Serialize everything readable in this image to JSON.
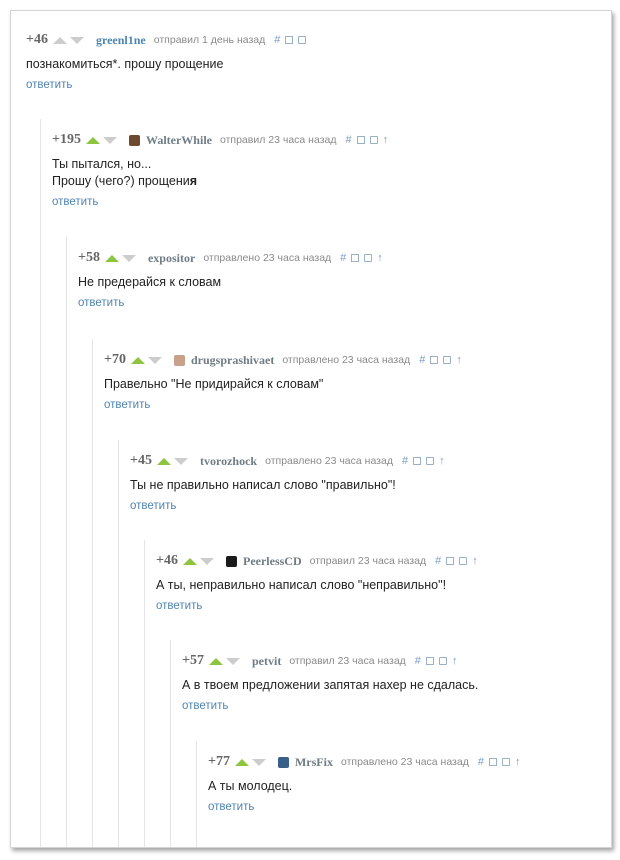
{
  "comments": [
    {
      "rating": "+46",
      "user": "greenl1ne",
      "meta": "отправил 1 день назад",
      "lines": [
        "познакомиться*. прошу прощение"
      ],
      "reply": "ответить",
      "up_active": false,
      "has_parent": false
    },
    {
      "rating": "+195",
      "user": "WalterWhile",
      "meta": "отправил 23 часа назад",
      "lines": [
        "Ты пытался, но...",
        "Прошу (чего?) прощени"
      ],
      "last_bold": "я",
      "reply": "ответить",
      "up_active": true,
      "has_parent": true,
      "avatar": "#6b4a2e"
    },
    {
      "rating": "+58",
      "user": "expositor",
      "meta": "отправлено 23 часа назад",
      "lines": [
        "Не предерайся к словам"
      ],
      "reply": "ответить",
      "up_active": true,
      "has_parent": true
    },
    {
      "rating": "+70",
      "user": "drugsprashivaet",
      "meta": "отправлено 23 часа назад",
      "lines": [
        "Правельно \"Не придирайся к словам\""
      ],
      "reply": "ответить",
      "up_active": true,
      "has_parent": true,
      "avatar": "#c9a089"
    },
    {
      "rating": "+45",
      "user": "tvorozhock",
      "meta": "отправлено 23 часа назад",
      "lines": [
        "Ты не правильно написал слово \"правильно\"!"
      ],
      "reply": "ответить",
      "up_active": true,
      "has_parent": true
    },
    {
      "rating": "+46",
      "user": "PeerlessCD",
      "meta": "отправил 23 часа назад",
      "lines": [
        "А ты, неправильно написал слово \"неправильно\"!"
      ],
      "reply": "ответить",
      "up_active": true,
      "has_parent": true,
      "avatar": "#1a1a1a"
    },
    {
      "rating": "+57",
      "user": "petvit",
      "meta": "отправил 23 часа назад",
      "lines": [
        "А в твоем предложении запятая нахер не сдалась."
      ],
      "reply": "ответить",
      "up_active": true,
      "has_parent": true
    },
    {
      "rating": "+77",
      "user": "MrsFix",
      "meta": "отправлено 23 часа назад",
      "lines": [
        "А ты молодец."
      ],
      "reply": "ответить",
      "up_active": true,
      "has_parent": true,
      "avatar": "#3a5f88"
    }
  ],
  "tools": {
    "hash": "#",
    "collapse": "collapse-icon",
    "save": "save-icon",
    "parent": "↑"
  },
  "colors": {
    "vote_up": "#8dc540",
    "vote_neutral": "#cdcdcd",
    "link": "#4f84b0"
  }
}
